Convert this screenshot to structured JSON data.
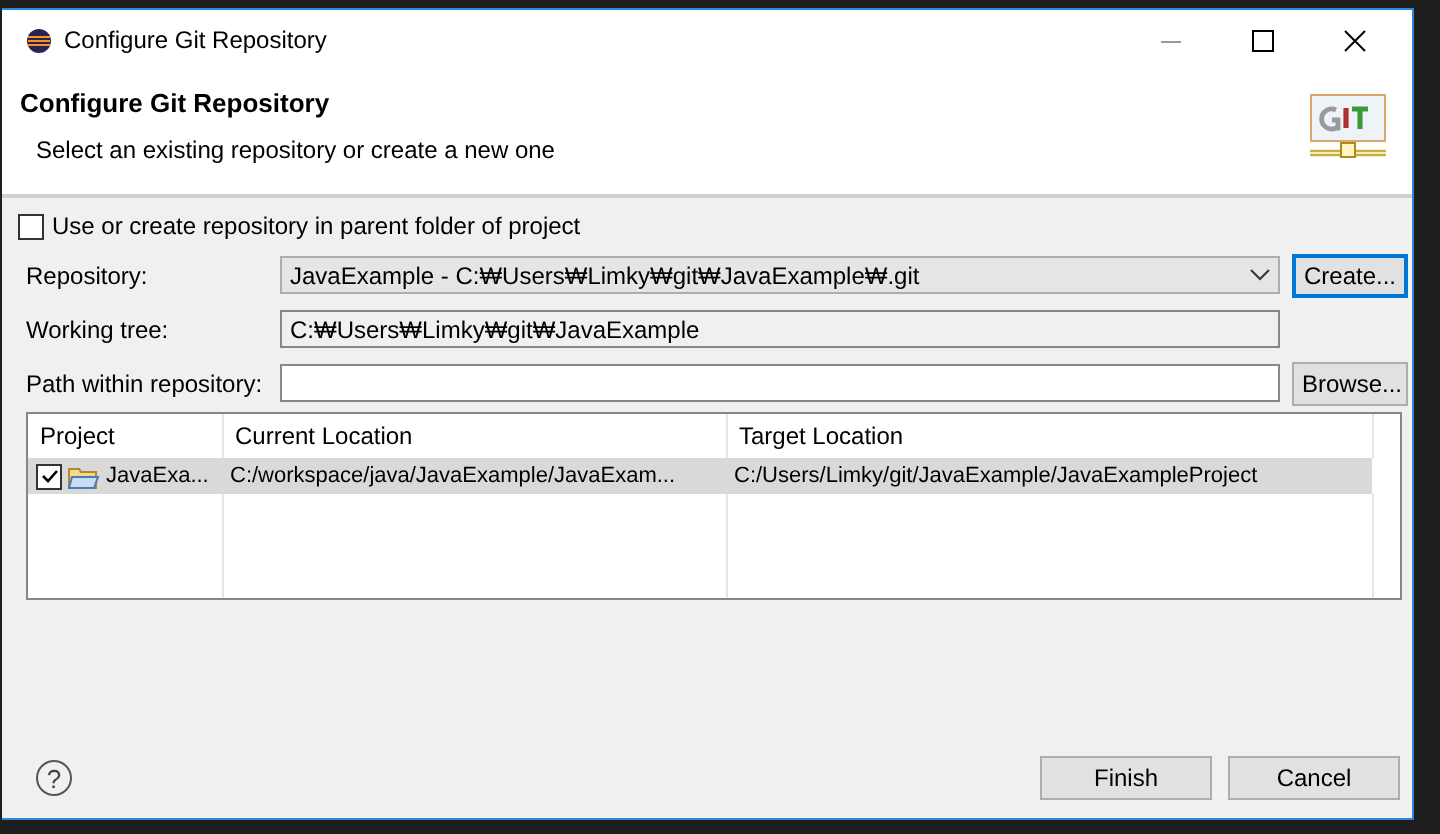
{
  "window": {
    "title": "Configure Git Repository"
  },
  "header": {
    "title": "Configure Git Repository",
    "description": "Select an existing repository or create a new one"
  },
  "parent_folder_option": {
    "label": "Use or create repository in parent folder of project",
    "checked": false
  },
  "fields": [
    {
      "kind": "dropdown",
      "label": "Repository:",
      "value": "JavaExample - C:₩Users₩Limky₩git₩JavaExample₩.git",
      "button": {
        "label": "Create...",
        "focused": true
      }
    },
    {
      "kind": "readonly",
      "label": "Working tree:",
      "value": "C:₩Users₩Limky₩git₩JavaExample"
    },
    {
      "kind": "input",
      "label": "Path within repository:",
      "button": {
        "label": "Browse...",
        "focused": false
      }
    }
  ],
  "table": {
    "columns": [
      "Project",
      "Current Location",
      "Target Location"
    ],
    "rows": [
      {
        "checked": true,
        "selected": true,
        "cells": [
          "JavaExa...",
          "C:/workspace/java/JavaExample/JavaExam...",
          "C:/Users/Limky/git/JavaExample/JavaExampleProject"
        ]
      }
    ]
  },
  "footer": {
    "help": "?",
    "buttons": [
      {
        "label": "Finish"
      },
      {
        "label": "Cancel"
      }
    ]
  }
}
